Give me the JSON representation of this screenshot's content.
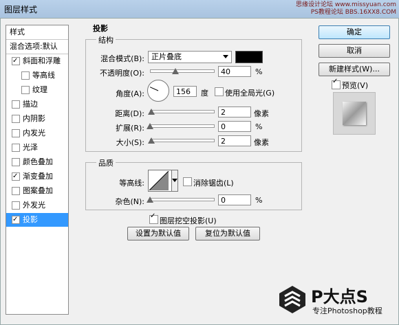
{
  "window": {
    "title": "图层样式"
  },
  "watermark": {
    "line1": "思缘设计论坛 www.missyuan.com",
    "line2": "PS教程论坛 BBS.16XX8.COM"
  },
  "styles_list": {
    "header": "样式",
    "blend_options": "混合选项:默认",
    "items": [
      {
        "label": "斜面和浮雕",
        "checked": true
      },
      {
        "label": "等高线",
        "checked": false
      },
      {
        "label": "纹理",
        "checked": false
      },
      {
        "label": "描边",
        "checked": false
      },
      {
        "label": "内阴影",
        "checked": false
      },
      {
        "label": "内发光",
        "checked": false
      },
      {
        "label": "光泽",
        "checked": false
      },
      {
        "label": "颜色叠加",
        "checked": false
      },
      {
        "label": "渐变叠加",
        "checked": true
      },
      {
        "label": "图案叠加",
        "checked": false
      },
      {
        "label": "外发光",
        "checked": false
      },
      {
        "label": "投影",
        "checked": true
      }
    ]
  },
  "drop_shadow": {
    "title": "投影",
    "structure_title": "结构",
    "blend_mode_label": "混合模式(B):",
    "blend_mode_value": "正片叠底",
    "shadow_color": "#000000",
    "opacity_label": "不透明度(O):",
    "opacity_value": "40",
    "opacity_unit": "%",
    "opacity_fraction": 0.4,
    "angle_label": "角度(A):",
    "angle_value": "156",
    "angle_unit": "度",
    "global_light_label": "使用全局光(G)",
    "global_light_checked": false,
    "distance_label": "距离(D):",
    "distance_value": "2",
    "distance_unit": "像素",
    "spread_label": "扩展(R):",
    "spread_value": "0",
    "spread_unit": "%",
    "size_label": "大小(S):",
    "size_value": "2",
    "size_unit": "像素",
    "quality_title": "品质",
    "contour_label": "等高线:",
    "antialias_label": "消除锯齿(L)",
    "antialias_checked": false,
    "noise_label": "杂色(N):",
    "noise_value": "0",
    "noise_unit": "%",
    "knockout_label": "图层挖空投影(U)",
    "knockout_checked": true,
    "make_default_btn": "设置为默认值",
    "reset_default_btn": "复位为默认值"
  },
  "actions": {
    "ok": "确定",
    "cancel": "取消",
    "new_style": "新建样式(W)...",
    "preview_label": "预览(V)",
    "preview_checked": true
  },
  "branding": {
    "name": "P大点S",
    "tagline": "专注Photoshop教程"
  }
}
